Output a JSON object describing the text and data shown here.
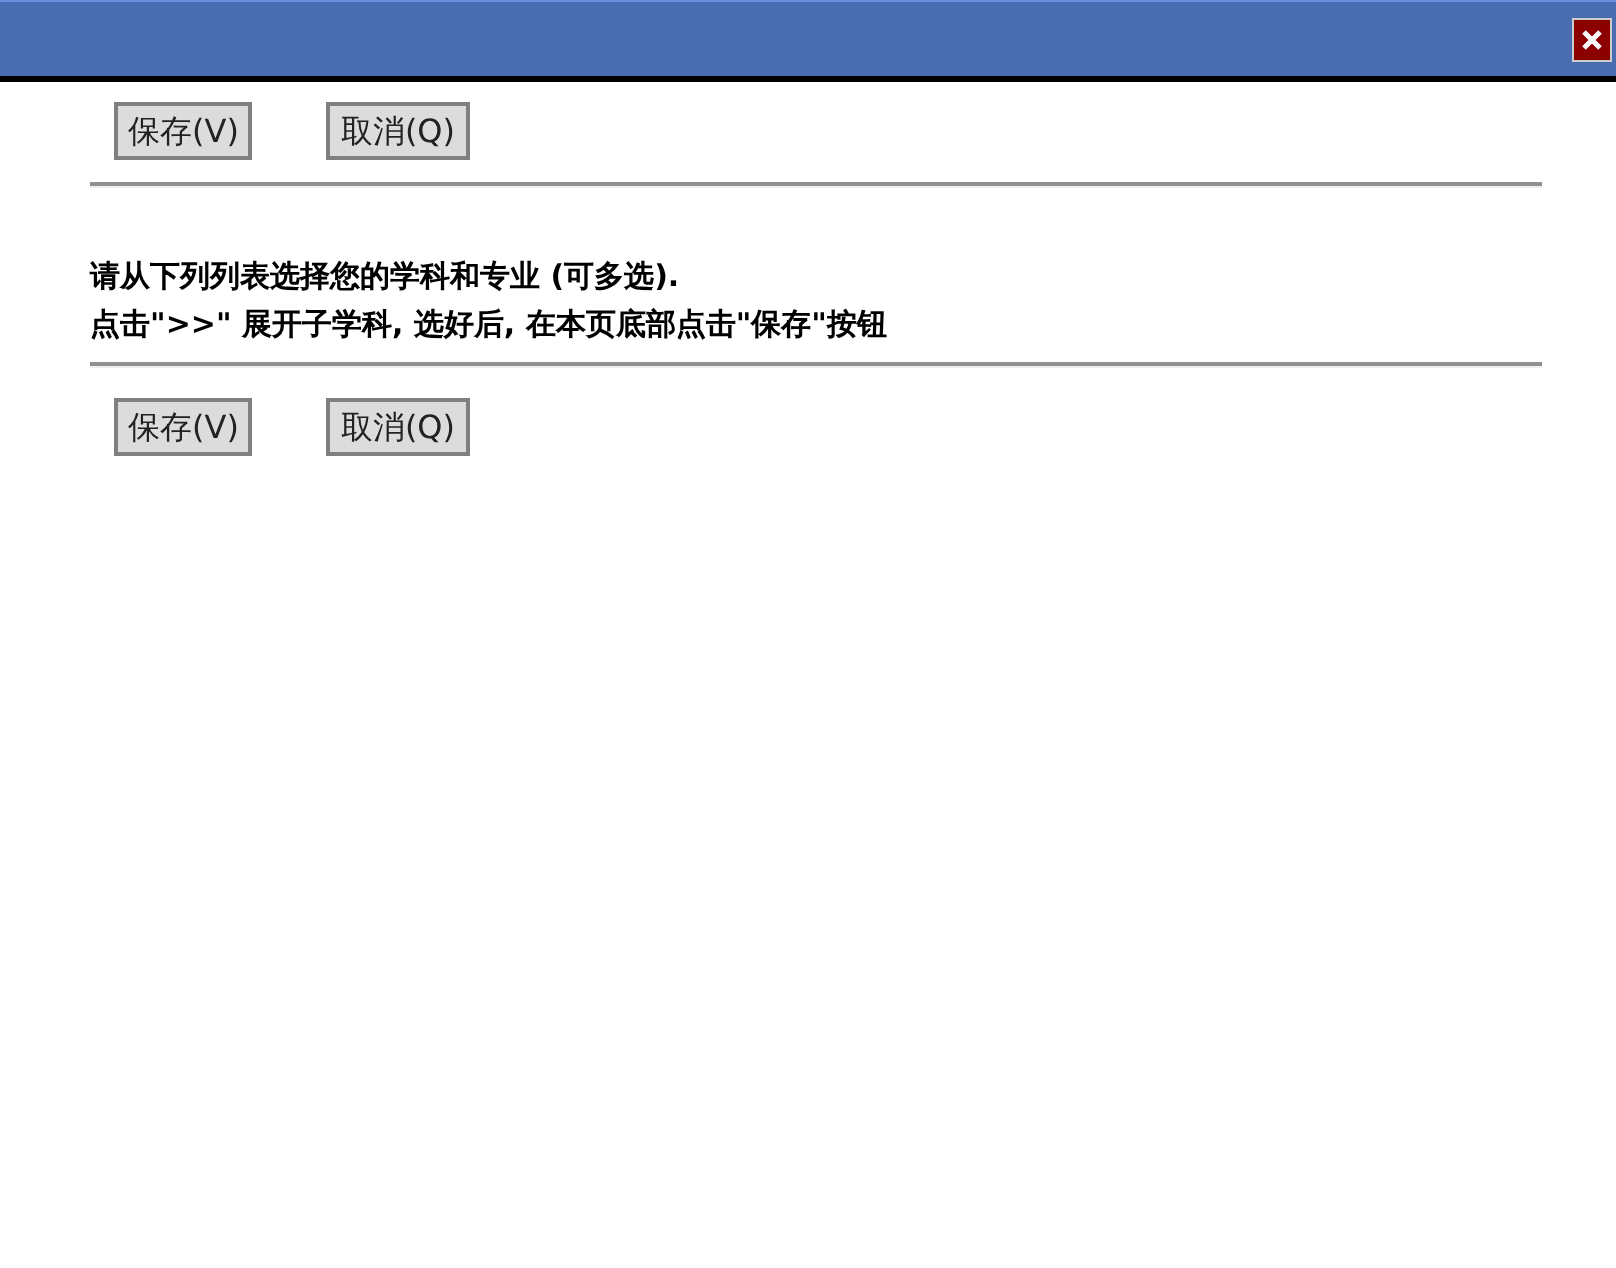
{
  "top_buttons": [
    "保存(V)",
    "取消(Q)"
  ],
  "instructions": [
    "请从下列列表选择您的学科和专业 (可多选).",
    "点击\">>\" 展开子学科, 选好后, 在本页底部点击\"保存\"按钮"
  ],
  "bottom_buttons": [
    "保存(V)",
    "取消(Q)"
  ]
}
